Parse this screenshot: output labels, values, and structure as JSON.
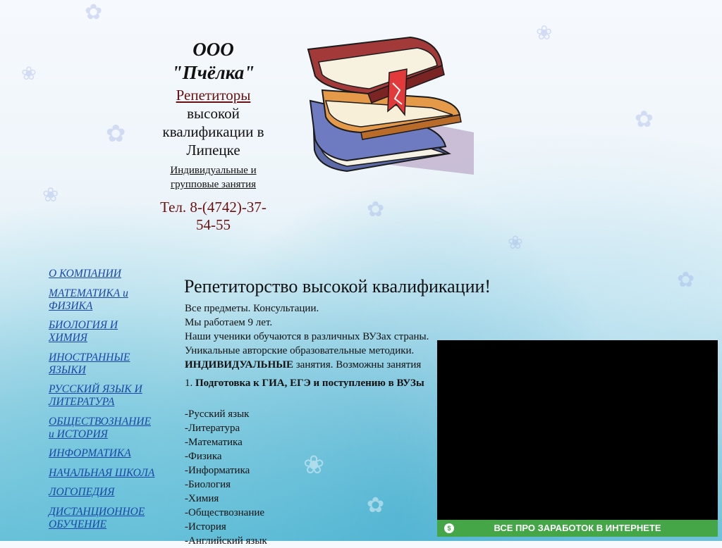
{
  "header": {
    "company_prefix": "ООО",
    "company_name": "\"Пчёлка\"",
    "tutors_link": "Репетиторы",
    "tutors_desc": "высокой квалификации в Липецке",
    "groups_link": "Индивидуальные и групповые занятия",
    "phone": "Тел. 8-(4742)-37-54-55"
  },
  "nav": {
    "items": [
      "О КОМПАНИИ",
      "МАТЕМАТИКА и ФИЗИКА",
      "БИОЛОГИЯ И ХИМИЯ",
      "ИНОСТРАННЫЕ ЯЗЫКИ",
      "РУССКИЙ ЯЗЫК И ЛИТЕРАТУРА",
      "ОБЩЕСТВОЗНАНИЕ и ИСТОРИЯ",
      "ИНФОРМАТИКА",
      "НАЧАЛЬНАЯ ШКОЛА",
      "ЛОГОПЕДИЯ",
      "ДИСТАНЦИОННОЕ ОБУЧЕНИЕ"
    ]
  },
  "main": {
    "title": "Репетиторство высокой квалификации!",
    "intro": [
      "Все предметы. Консультации.",
      "Мы работаем 9 лет.",
      "Наши ученики обучаются в различных ВУЗах страны.",
      "Уникальные авторские образовательные методики."
    ],
    "individual_bold": "ИНДИВИДУАЛЬНЫЕ",
    "individual_rest": " занятия. Возможны занятия",
    "prep_number": "1. ",
    "prep_bold": "Подготовка к ГИА, ЕГЭ и поступлению в ВУЗы",
    "subjects": [
      "-Русский язык",
      "-Литература",
      "-Математика",
      "-Физика",
      "-Информатика",
      "-Биология",
      "-Химия",
      "-Обществознание",
      "-История",
      "-Английский язык"
    ]
  },
  "banner": {
    "icon": "dollar-icon",
    "text_normal": "ВСЕ ПРО ",
    "text_bold": "ЗАРАБОТОК В ИНТЕРНЕТЕ"
  }
}
